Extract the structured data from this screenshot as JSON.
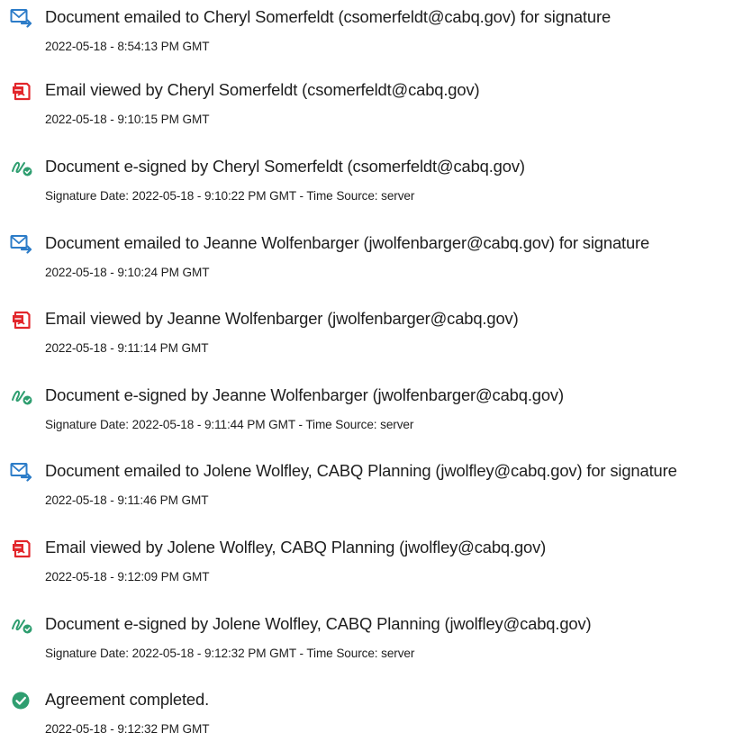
{
  "audit_log": {
    "entries": [
      {
        "icon": "email-sent-icon",
        "title": "Document emailed to Cheryl Somerfeldt (csomerfeldt@cabq.gov) for signature",
        "detail": "2022-05-18 - 8:54:13 PM GMT"
      },
      {
        "icon": "document-viewed-icon",
        "title": "Email viewed by Cheryl Somerfeldt (csomerfeldt@cabq.gov)",
        "detail": "2022-05-18 - 9:10:15 PM GMT"
      },
      {
        "icon": "e-signed-icon",
        "title": "Document e-signed by Cheryl Somerfeldt (csomerfeldt@cabq.gov)",
        "detail": "Signature Date: 2022-05-18 - 9:10:22 PM GMT - Time Source: server"
      },
      {
        "icon": "email-sent-icon",
        "title": "Document emailed to Jeanne Wolfenbarger (jwolfenbarger@cabq.gov) for signature",
        "detail": "2022-05-18 - 9:10:24 PM GMT"
      },
      {
        "icon": "document-viewed-icon",
        "title": "Email viewed by Jeanne Wolfenbarger (jwolfenbarger@cabq.gov)",
        "detail": "2022-05-18 - 9:11:14 PM GMT"
      },
      {
        "icon": "e-signed-icon",
        "title": "Document e-signed by Jeanne Wolfenbarger (jwolfenbarger@cabq.gov)",
        "detail": "Signature Date: 2022-05-18 - 9:11:44 PM GMT - Time Source: server"
      },
      {
        "icon": "email-sent-icon",
        "title": "Document emailed to Jolene Wolfley, CABQ Planning (jwolfley@cabq.gov) for signature",
        "detail": "2022-05-18 - 9:11:46 PM GMT"
      },
      {
        "icon": "document-viewed-icon",
        "title": "Email viewed by Jolene Wolfley, CABQ Planning (jwolfley@cabq.gov)",
        "detail": "2022-05-18 - 9:12:09 PM GMT"
      },
      {
        "icon": "e-signed-icon",
        "title": "Document e-signed by Jolene Wolfley, CABQ Planning (jwolfley@cabq.gov)",
        "detail": "Signature Date: 2022-05-18 - 9:12:32 PM GMT - Time Source: server"
      },
      {
        "icon": "agreement-completed-icon",
        "title": "Agreement completed.",
        "detail": "2022-05-18 - 9:12:32 PM GMT"
      }
    ]
  },
  "colors": {
    "text": "#1e1e1e",
    "email_icon": "#2c7cc8",
    "viewed_icon": "#e2262b",
    "signed_icon": "#2f9e70",
    "completed_icon": "#2f9e70"
  }
}
